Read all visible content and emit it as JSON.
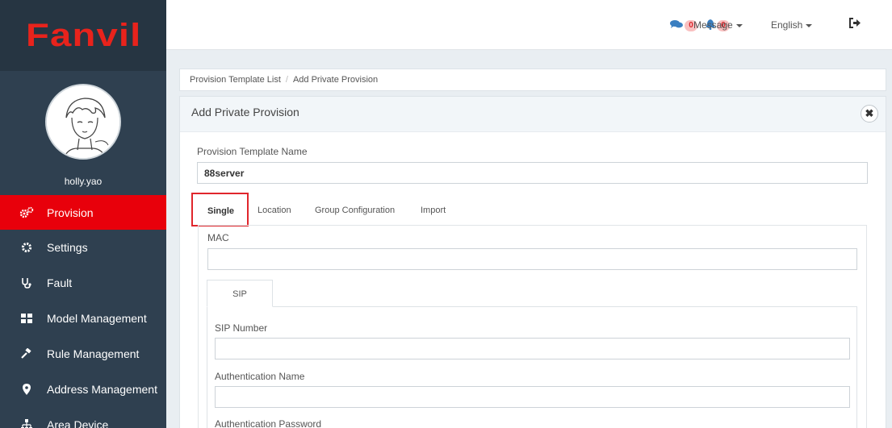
{
  "sidebar": {
    "logo": "Fanvil",
    "username": "holly.yao",
    "items": [
      {
        "label": "Provision",
        "icon": "gears-icon",
        "active": true
      },
      {
        "label": "Settings",
        "icon": "gear-icon"
      },
      {
        "label": "Fault",
        "icon": "stethoscope-icon"
      },
      {
        "label": "Model Management",
        "icon": "grid-icon"
      },
      {
        "label": "Rule Management",
        "icon": "gavel-icon"
      },
      {
        "label": "Address Management",
        "icon": "map-marker-icon"
      },
      {
        "label": "Area Device",
        "icon": "sitemap-icon"
      }
    ]
  },
  "topbar": {
    "comments_count": "0",
    "alerts_count": "0",
    "message_label": "Message",
    "language_label": "English",
    "logout_icon": "sign-out-icon"
  },
  "breadcrumb": {
    "parent": "Provision Template List",
    "separator": "/",
    "current": "Add Private Provision"
  },
  "panel": {
    "title": "Add Private Provision",
    "close_icon": "close-icon",
    "template_name_label": "Provision Template Name",
    "template_name_value": "88server",
    "tabs": [
      {
        "label": "Single",
        "active": true
      },
      {
        "label": "Location"
      },
      {
        "label": "Group Configuration"
      },
      {
        "label": "Import"
      }
    ],
    "mac_label": "MAC",
    "mac_value": "",
    "sub_tabs": [
      {
        "label": "SIP",
        "active": true
      }
    ],
    "sip_number_label": "SIP Number",
    "sip_number_value": "",
    "auth_name_label": "Authentication Name",
    "auth_name_value": "",
    "auth_password_label": "Authentication Password"
  },
  "colors": {
    "accent": "#e8000b",
    "sidebar_bg": "#2f4050",
    "highlight_border": "#e0262c"
  }
}
